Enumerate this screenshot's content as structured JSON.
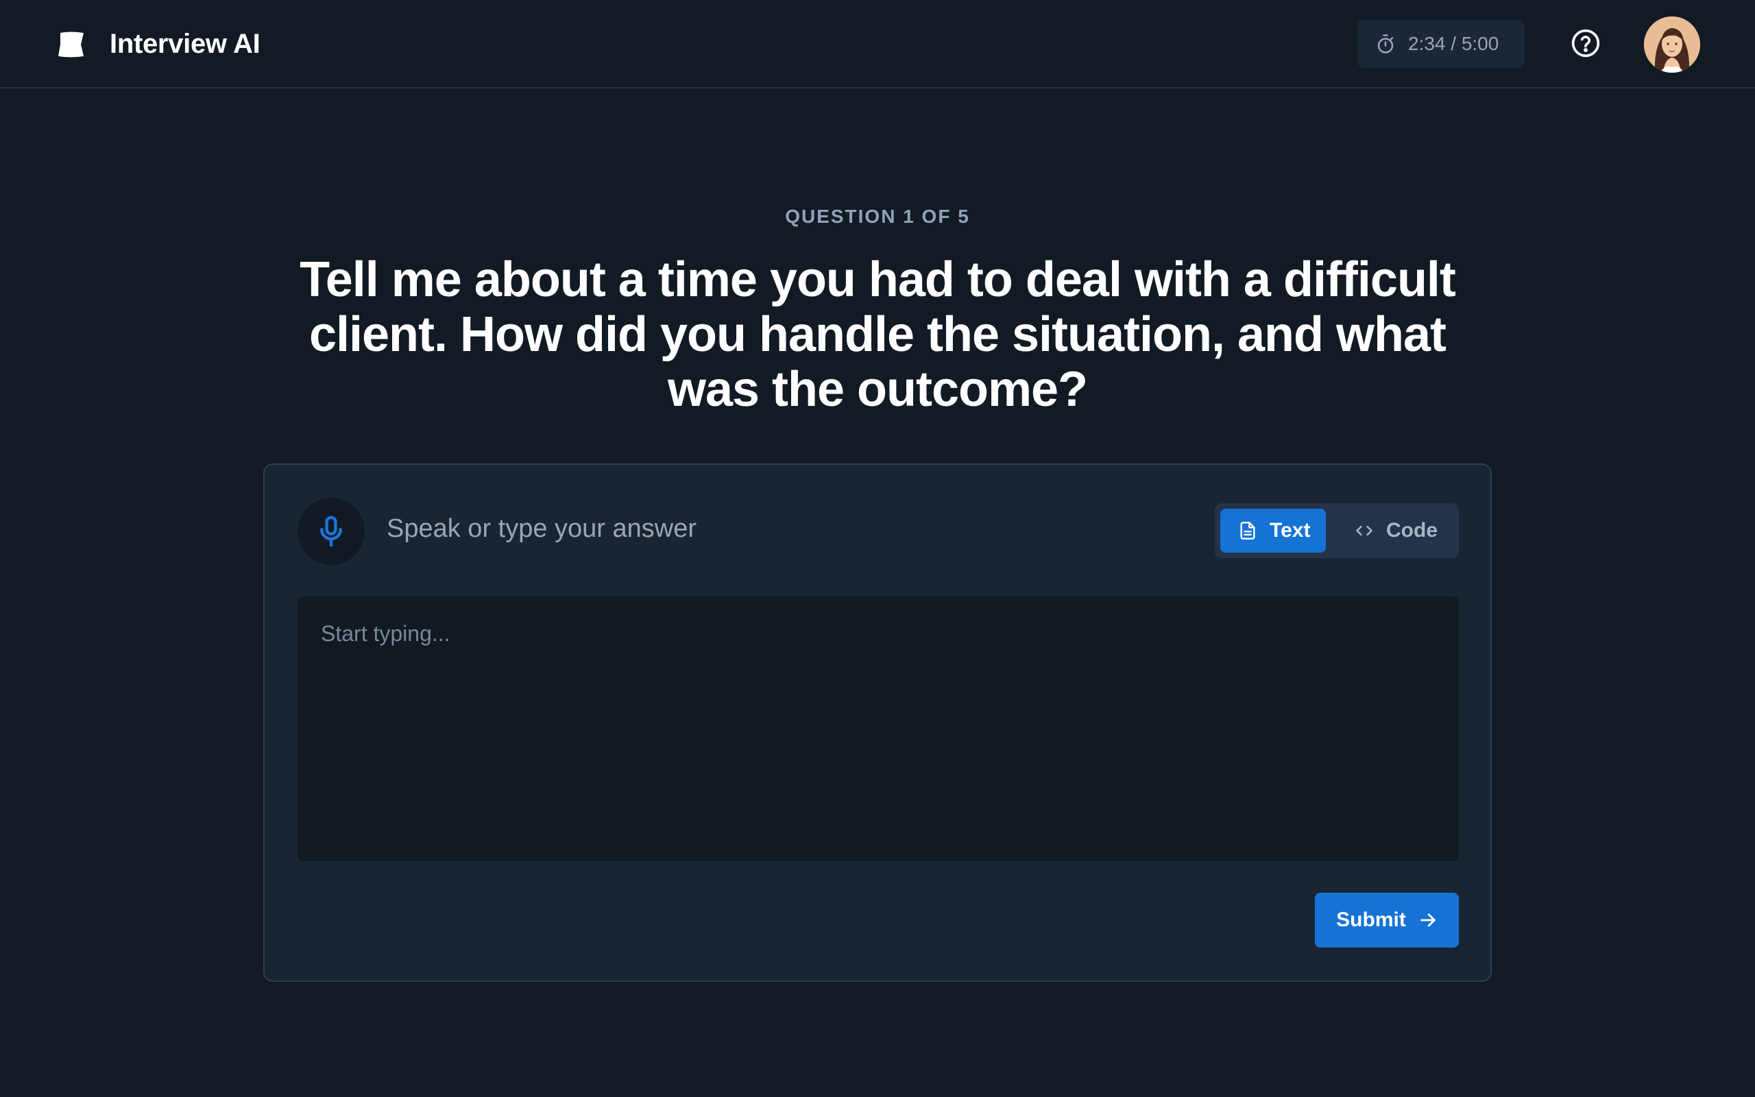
{
  "header": {
    "brand_name": "Interview AI",
    "timer": "2:34 / 5:00",
    "icons": {
      "logo": "flag-logo-icon",
      "timer": "stopwatch-icon",
      "help": "help-circle-icon",
      "avatar": "user-avatar"
    }
  },
  "main": {
    "eyebrow": "QUESTION 1 OF 5",
    "question": "Tell me about a time you had to deal with a difficult client. How did you handle the situation, and what was the outcome?"
  },
  "answer": {
    "prompt_label": "Speak or type your answer",
    "modes": [
      {
        "label": "Text",
        "icon": "document-icon",
        "active": true
      },
      {
        "label": "Code",
        "icon": "code-brackets-icon",
        "active": false
      }
    ],
    "editor_placeholder": "Start typing...",
    "editor_value": "",
    "submit_label": "Submit"
  },
  "colors": {
    "background": "#121a24",
    "card": "#1a2534",
    "accent": "#1673d6",
    "muted_text": "#97a6b8"
  }
}
